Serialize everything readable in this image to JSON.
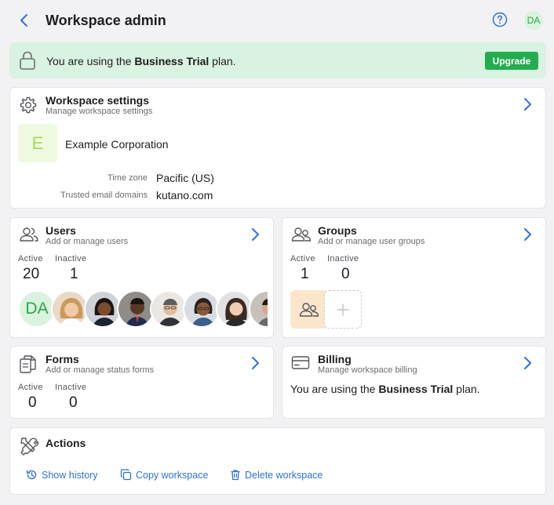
{
  "header": {
    "title": "Workspace admin",
    "user_initials": "DA"
  },
  "banner": {
    "prefix": "You are using the ",
    "plan": "Business Trial",
    "suffix": " plan.",
    "upgrade_label": "Upgrade"
  },
  "workspace_settings": {
    "title": "Workspace settings",
    "subtitle": "Manage workspace settings",
    "logo_letter": "E",
    "name": "Example Corporation",
    "timezone_label": "Time zone",
    "timezone_value": "Pacific (US)",
    "domains_label": "Trusted email domains",
    "domains_value": "kutano.com"
  },
  "users": {
    "title": "Users",
    "subtitle": "Add or manage users",
    "active_label": "Active",
    "active_count": "20",
    "inactive_label": "Inactive",
    "inactive_count": "1",
    "first_avatar_initials": "DA"
  },
  "groups": {
    "title": "Groups",
    "subtitle": "Add or manage user groups",
    "active_label": "Active",
    "active_count": "1",
    "inactive_label": "Inactive",
    "inactive_count": "0"
  },
  "forms": {
    "title": "Forms",
    "subtitle": "Add or manage status forms",
    "active_label": "Active",
    "active_count": "0",
    "inactive_label": "Inactive",
    "inactive_count": "0"
  },
  "billing": {
    "title": "Billing",
    "subtitle": "Manage workspace billing",
    "prefix": "You are using the ",
    "plan": "Business Trial",
    "suffix": " plan."
  },
  "actions": {
    "title": "Actions",
    "show_history": "Show history",
    "copy_workspace": "Copy workspace",
    "delete_workspace": "Delete workspace"
  },
  "colors": {
    "accent_blue": "#2f71d6",
    "upgrade_green": "#24ad4f",
    "banner_bg": "#d9f2e1",
    "avatar_green": "#2fa54c"
  }
}
